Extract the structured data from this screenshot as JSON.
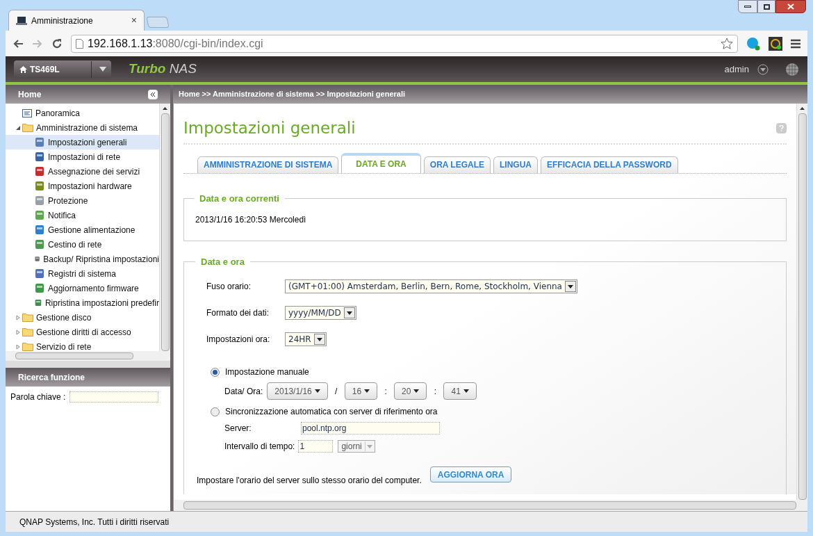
{
  "browser": {
    "tab_title": "Amministrazione",
    "tab_close": "×",
    "address_host": "192.168.1.13",
    "address_rest": ":8080/cgi-bin/index.cgi"
  },
  "header": {
    "device": "TS469L",
    "brand_bold": "Turbo",
    "brand_rest": "NAS",
    "user": "admin"
  },
  "sidebar": {
    "title": "Home",
    "tree": [
      {
        "label": "Panoramica",
        "selected": false
      },
      {
        "label": "Amministrazione di sistema",
        "expanded": true,
        "selected": false,
        "children": [
          {
            "label": "Impostazioni generali",
            "selected": true
          },
          {
            "label": "Impostazioni di rete",
            "selected": false
          },
          {
            "label": "Assegnazione dei servizi",
            "selected": false
          },
          {
            "label": "Impostazioni hardware",
            "selected": false
          },
          {
            "label": "Protezione",
            "selected": false
          },
          {
            "label": "Notifica",
            "selected": false
          },
          {
            "label": "Gestione alimentazione",
            "selected": false
          },
          {
            "label": "Cestino di rete",
            "selected": false
          },
          {
            "label": "Backup/ Ripristina impostazioni",
            "selected": false
          },
          {
            "label": "Registri di sistema",
            "selected": false
          },
          {
            "label": "Aggiornamento firmware",
            "selected": false
          },
          {
            "label": "Ripristina impostazioni predefir",
            "selected": false
          }
        ]
      },
      {
        "label": "Gestione disco",
        "expanded": false,
        "selected": false
      },
      {
        "label": "Gestione diritti di accesso",
        "expanded": false,
        "selected": false
      },
      {
        "label": "Servizio di rete",
        "expanded": false,
        "selected": false
      }
    ]
  },
  "search": {
    "title": "Ricerca funzione",
    "label": "Parola chiave :"
  },
  "breadcrumb": "Home >> Amministrazione di sistema >> Impostazioni generali",
  "page_title": "Impostazioni generali",
  "tabs": [
    {
      "label": "AMMINISTRAZIONE DI SISTEMA",
      "selected": false
    },
    {
      "label": "DATA E ORA",
      "selected": true
    },
    {
      "label": "ORA LEGALE",
      "selected": false
    },
    {
      "label": "LINGUA",
      "selected": false
    },
    {
      "label": "EFFICACIA DELLA PASSWORD",
      "selected": false
    }
  ],
  "current": {
    "title": "Data e ora correnti",
    "value": "2013/1/16 16:20:53 Mercoledì"
  },
  "settings": {
    "title": "Data e ora",
    "fields": [
      {
        "label": "Fuso orario:",
        "value": "(GMT+01:00) Amsterdam, Berlin, Bern, Rome, Stockholm, Vienna"
      },
      {
        "label": "Formato dei dati:",
        "value": "yyyy/MM/DD"
      },
      {
        "label": "Impostazioni ora:",
        "value": "24HR"
      }
    ],
    "manual": {
      "label": "Impostazione manuale",
      "selected": true,
      "row_label": "Data/ Ora:",
      "parts": [
        {
          "value": "2013/1/16",
          "sep": "/"
        },
        {
          "value": "16",
          "sep": ":"
        },
        {
          "value": "20",
          "sep": ":"
        },
        {
          "value": "41"
        }
      ]
    },
    "auto": {
      "label": "Sincronizzazione automatica con server di riferimento ora",
      "selected": false,
      "server_label": "Server:",
      "server": "pool.ntp.org",
      "interval_label": "Intervallo di tempo:",
      "interval": "1",
      "unit": "giorni",
      "disabled": true
    },
    "hint": "Impostare l'orario del server sullo stesso orario del computer.",
    "button": "AGGIORNA ORA"
  },
  "footer": "QNAP Systems, Inc. Tutti i diritti riservati"
}
